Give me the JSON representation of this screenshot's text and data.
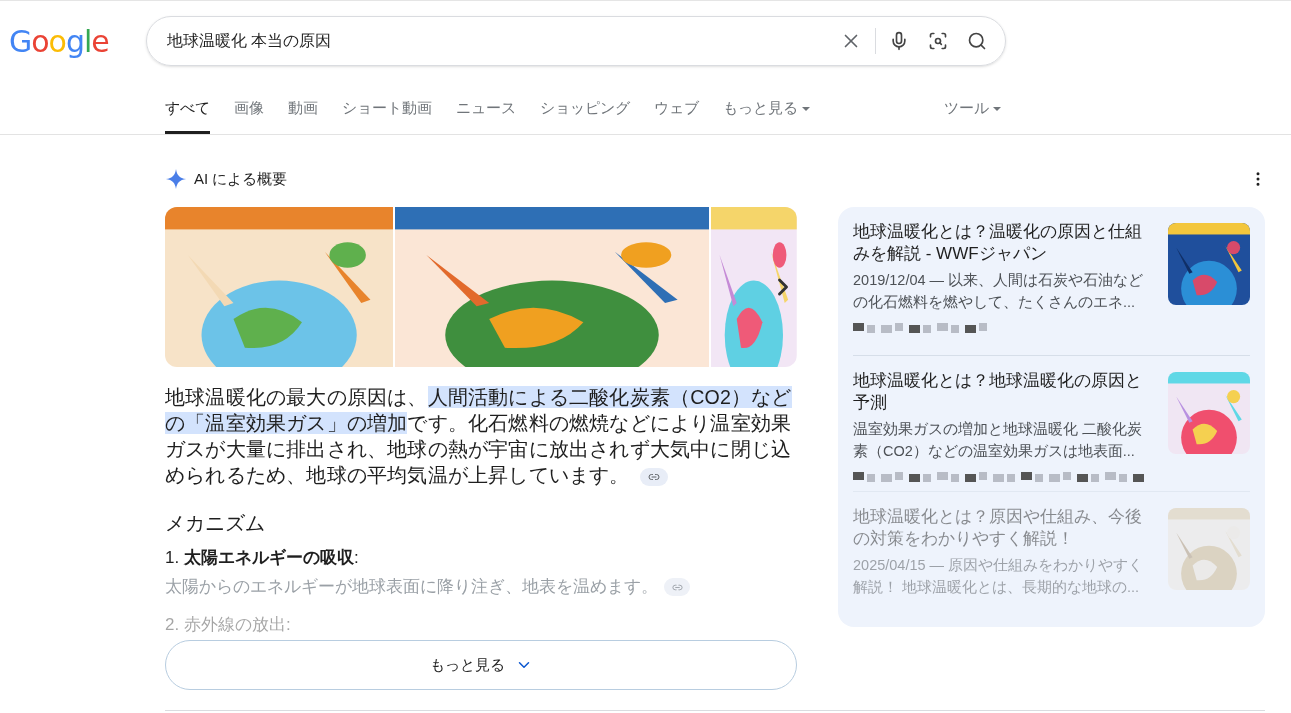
{
  "logo": "Google",
  "search": {
    "value": "地球温暖化 本当の原因"
  },
  "tabs": [
    {
      "label": "すべて",
      "selected": true,
      "dropdown": false
    },
    {
      "label": "画像",
      "selected": false,
      "dropdown": false
    },
    {
      "label": "動画",
      "selected": false,
      "dropdown": false
    },
    {
      "label": "ショート動画",
      "selected": false,
      "dropdown": false
    },
    {
      "label": "ニュース",
      "selected": false,
      "dropdown": false
    },
    {
      "label": "ショッピング",
      "selected": false,
      "dropdown": false
    },
    {
      "label": "ウェブ",
      "selected": false,
      "dropdown": false
    },
    {
      "label": "もっと見る",
      "selected": false,
      "dropdown": true
    }
  ],
  "tools": {
    "label": "ツール"
  },
  "ai_overview": {
    "title": "AI による概要",
    "summary": [
      {
        "text": "地球温暖化の最大の原因は、",
        "highlighted": false
      },
      {
        "text": "人間活動による二酸化炭素（CO2）などの「温室効果ガス」の増加",
        "highlighted": true
      },
      {
        "text": "です。化石燃料の燃焼などにより温室効果ガスが大量に排出され、地球の熱が宇宙に放出されず大気中に閉じ込められるため、地球の平均気温が上昇しています。",
        "highlighted": false
      }
    ],
    "heading": "メカニズム",
    "items": [
      {
        "title": "1. **太陽エネルギーの吸収**:",
        "text": "太陽からのエネルギーが地球表面に降り注ぎ、地表を温めます。",
        "faded": false
      },
      {
        "title": "2. 赤外線の放出:",
        "faded": true
      }
    ],
    "more_button": "もっと見る"
  },
  "sources": [
    {
      "title": "地球温暖化とは？温暖化の原因と仕組みを解説 - WWFジャパン",
      "snippet": "2019/12/04 — 以来、人間は石炭や石油などの化石燃料を燃やして、たくさんのエネ...",
      "faded": false
    },
    {
      "title": "地球温暖化とは？地球温暖化の原因と予測",
      "snippet": "温室効果ガスの増加と地球温暖化 二酸化炭素（CO2）などの温室効果ガスは地表面...",
      "faded": false
    },
    {
      "title": "地球温暖化とは？原因や仕組み、今後の対策をわかりやすく解説！",
      "snippet": "2025/04/15 — 原因や仕組みをわかりやすく解説！ 地球温暖化とは、長期的な地球の...",
      "faded": true
    }
  ]
}
